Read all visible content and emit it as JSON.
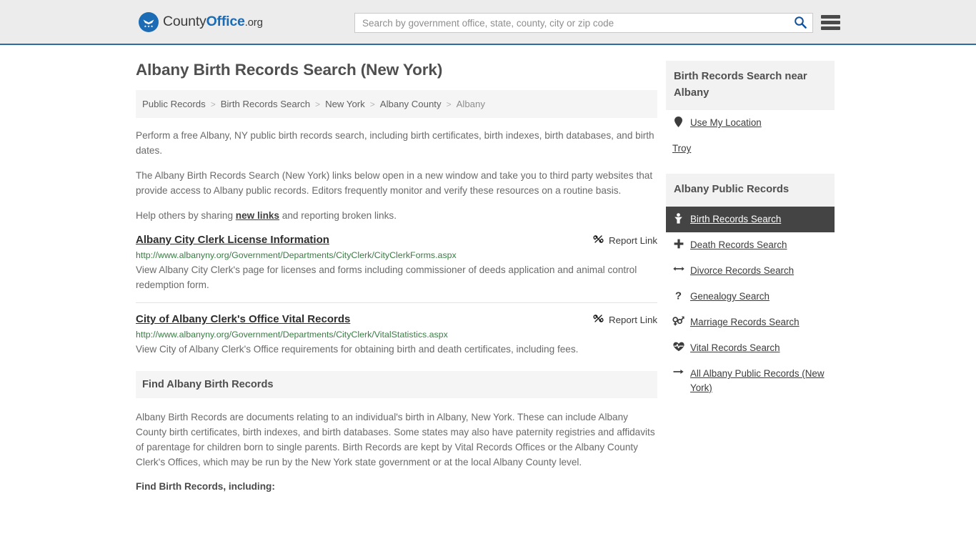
{
  "header": {
    "brand": {
      "part1": "County",
      "part2": "Office",
      "part3": ".org",
      "seal_icon": "eagle-seal-icon"
    },
    "search": {
      "placeholder": "Search by government office, state, county, city or zip code",
      "value": "",
      "icon": "search-icon"
    },
    "menu_icon": "hamburger-menu-icon",
    "accent_color": "#2d6ca2",
    "background_color": "#ececec"
  },
  "main": {
    "title": "Albany Birth Records Search (New York)",
    "breadcrumb": [
      {
        "label": "Public Records",
        "current": false
      },
      {
        "label": "Birth Records Search",
        "current": false
      },
      {
        "label": "New York",
        "current": false
      },
      {
        "label": "Albany County",
        "current": false
      },
      {
        "label": "Albany",
        "current": true
      }
    ],
    "breadcrumb_separator": ">",
    "intro_paragraph": "Perform a free Albany, NY public birth records search, including birth certificates, birth indexes, birth databases, and birth dates.",
    "disclaimer_paragraph": "The Albany Birth Records Search (New York) links below open in a new window and take you to third party websites that provide access to Albany public records. Editors frequently monitor and verify these resources on a routine basis.",
    "help_prefix": "Help others by sharing ",
    "help_link": "new links",
    "help_suffix": " and reporting broken links.",
    "report_link_label": "Report Link",
    "report_link_icon": "broken-link-icon",
    "results": [
      {
        "title": "Albany City Clerk License Information",
        "url": "http://www.albanyny.org/Government/Departments/CityClerk/CityClerkForms.aspx",
        "description": "View Albany City Clerk's page for licenses and forms including commissioner of deeds application and animal control redemption form."
      },
      {
        "title": "City of Albany Clerk's Office Vital Records",
        "url": "http://www.albanyny.org/Government/Departments/CityClerk/VitalStatistics.aspx",
        "description": "View City of Albany Clerk's Office requirements for obtaining birth and death certificates, including fees."
      }
    ],
    "find_section": {
      "heading": "Find Albany Birth Records",
      "body": "Albany Birth Records are documents relating to an individual's birth in Albany, New York. These can include Albany County birth certificates, birth indexes, and birth databases. Some states may also have paternity registries and affidavits of parentage for children born to single parents. Birth Records are kept by Vital Records Offices or the Albany County Clerk's Offices, which may be run by the New York state government or at the local Albany County level.",
      "subheading": "Find Birth Records, including:"
    }
  },
  "sidebar": {
    "near_panel": {
      "heading": "Birth Records Search near Albany",
      "items": [
        {
          "label": "Use My Location",
          "icon": "map-pin-icon",
          "has_icon": true
        },
        {
          "label": "Troy",
          "icon": "",
          "has_icon": false
        }
      ]
    },
    "records_panel": {
      "heading": "Albany Public Records",
      "items": [
        {
          "label": "Birth Records Search",
          "icon": "baby-icon",
          "active": true
        },
        {
          "label": "Death Records Search",
          "icon": "cross-icon",
          "active": false
        },
        {
          "label": "Divorce Records Search",
          "icon": "arrows-split-icon",
          "active": false
        },
        {
          "label": "Genealogy Search",
          "icon": "question-mark-icon",
          "active": false
        },
        {
          "label": "Marriage Records Search",
          "icon": "venus-mars-icon",
          "active": false
        },
        {
          "label": "Vital Records Search",
          "icon": "heart-pulse-icon",
          "active": false
        },
        {
          "label": "All Albany Public Records (New York)",
          "icon": "arrow-right-icon",
          "active": false
        }
      ],
      "active_background": "#444444"
    }
  }
}
